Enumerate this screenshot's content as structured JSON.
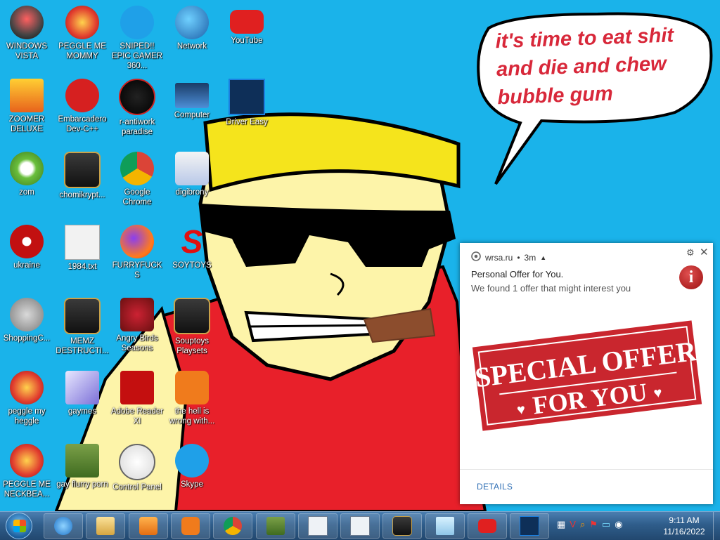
{
  "wallpaper": {
    "speech_bubble_text": "it's time to eat shit and die and chew bubble gum"
  },
  "desktop": {
    "icons": [
      {
        "label": "WINDOWS VISTA",
        "icon": "vista-orb-icon"
      },
      {
        "label": "PEGGLE ME MOMMY",
        "icon": "peggle-icon"
      },
      {
        "label": "SNIPED!! EPIC GAMER 360...",
        "icon": "skype-icon"
      },
      {
        "label": "Network",
        "icon": "network-icon"
      },
      {
        "label": "YouTube",
        "icon": "youtube-icon"
      },
      {
        "label": "ZOOMER DELUXE",
        "icon": "zoomer-icon"
      },
      {
        "label": "Embarcadero Dev-C++",
        "icon": "devcpp-icon"
      },
      {
        "label": "r-antiwork paradise",
        "icon": "antiwork-icon"
      },
      {
        "label": "Computer",
        "icon": "computer-icon"
      },
      {
        "label": "Driver Easy",
        "icon": "driver-easy-icon"
      },
      {
        "label": "zom",
        "icon": "zombie-flower-icon"
      },
      {
        "label": "chomikrypt...",
        "icon": "generic-app-icon"
      },
      {
        "label": "Google Chrome",
        "icon": "chrome-icon"
      },
      {
        "label": "digibrony",
        "icon": "digibrony-icon"
      },
      {
        "label": "ukraine",
        "icon": "radiation-icon"
      },
      {
        "label": "1984.txt",
        "icon": "text-file-icon"
      },
      {
        "label": "FURRYFUCKS",
        "icon": "firefox-icon"
      },
      {
        "label": "SOYTOYS",
        "icon": "soytoys-icon"
      },
      {
        "label": "ShoppingC...",
        "icon": "flash-icon"
      },
      {
        "label": "MEMZ DESTRUCTI...",
        "icon": "generic-app-icon"
      },
      {
        "label": "Angry Birds Seasons",
        "icon": "angry-birds-icon"
      },
      {
        "label": "Souptoys Playsets",
        "icon": "generic-app-icon"
      },
      {
        "label": "peggle my heggle",
        "icon": "peggle-icon"
      },
      {
        "label": "gaymes",
        "icon": "games-folder-icon"
      },
      {
        "label": "Adobe Reader XI",
        "icon": "adobe-reader-icon"
      },
      {
        "label": "the hell is wrong with...",
        "icon": "uc-browser-icon"
      },
      {
        "label": "PEGGLE ME NECKBEA...",
        "icon": "peggle-icon"
      },
      {
        "label": "gay flurry porn",
        "icon": "box-bear-icon"
      },
      {
        "label": "Control Panel",
        "icon": "control-panel-icon"
      },
      {
        "label": "Skype",
        "icon": "skype-icon"
      }
    ]
  },
  "notification": {
    "source": "wrsa.ru",
    "age": "3m",
    "title": "Personal Offer for You.",
    "body": "We found 1 offer that might interest you",
    "banner_line1": "SPECIAL OFFER",
    "banner_line2": "FOR YOU",
    "details_label": "DETAILS"
  },
  "taskbar": {
    "pinned": [
      "start-orb-icon",
      "ie-icon",
      "explorer-icon",
      "media-player-icon",
      "uc-browser-icon",
      "chrome-icon",
      "box-bear-icon",
      "window-icon",
      "window-icon",
      "generic-app-icon",
      "notepad-icon",
      "youtube-icon",
      "driver-easy-icon"
    ],
    "clock_time": "9:11 AM",
    "clock_date": "11/16/2022"
  },
  "colors": {
    "desktop": "#1ab3ea",
    "shirt": "#e8202a",
    "skin": "#fdf4a9",
    "hat": "#f5e41c",
    "bubble_text": "#d8283a",
    "banner": "#c9262e"
  }
}
